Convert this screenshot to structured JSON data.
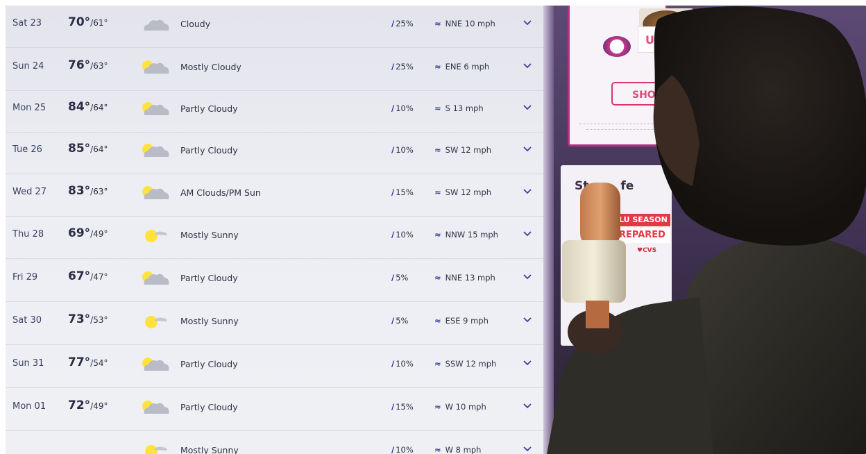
{
  "forecast": {
    "rows": [
      {
        "day": "Sat 23",
        "high": "70°",
        "low": "/61°",
        "condition": "Cloudy",
        "icon": "cloud-icon",
        "precip": "25%",
        "wind": "NNE 10 mph"
      },
      {
        "day": "Sun 24",
        "high": "76°",
        "low": "/63°",
        "condition": "Mostly Cloudy",
        "icon": "sun-cloud-icon",
        "precip": "25%",
        "wind": "ENE 6 mph"
      },
      {
        "day": "Mon 25",
        "high": "84°",
        "low": "/64°",
        "condition": "Partly Cloudy",
        "icon": "sun-cloud-icon",
        "precip": "10%",
        "wind": "S 13 mph"
      },
      {
        "day": "Tue 26",
        "high": "85°",
        "low": "/64°",
        "condition": "Partly Cloudy",
        "icon": "sun-cloud-icon",
        "precip": "10%",
        "wind": "SW 12 mph"
      },
      {
        "day": "Wed 27",
        "high": "83°",
        "low": "/63°",
        "condition": "AM Clouds/PM Sun",
        "icon": "sun-cloud-icon",
        "precip": "15%",
        "wind": "SW 12 mph"
      },
      {
        "day": "Thu 28",
        "high": "69°",
        "low": "/49°",
        "condition": "Mostly Sunny",
        "icon": "sun-icon",
        "precip": "10%",
        "wind": "NNW 15 mph"
      },
      {
        "day": "Fri 29",
        "high": "67°",
        "low": "/47°",
        "condition": "Partly Cloudy",
        "icon": "sun-cloud-icon",
        "precip": "5%",
        "wind": "NNE 13 mph"
      },
      {
        "day": "Sat 30",
        "high": "73°",
        "low": "/53°",
        "condition": "Mostly Sunny",
        "icon": "sun-icon",
        "precip": "5%",
        "wind": "ESE 9 mph"
      },
      {
        "day": "Sun 31",
        "high": "77°",
        "low": "/54°",
        "condition": "Partly Cloudy",
        "icon": "sun-cloud-icon",
        "precip": "10%",
        "wind": "SSW 12 mph"
      },
      {
        "day": "Mon 01",
        "high": "72°",
        "low": "/49°",
        "condition": "Partly Cloudy",
        "icon": "sun-cloud-icon",
        "precip": "15%",
        "wind": "W 10 mph"
      },
      {
        "day": "",
        "high": "",
        "low": "",
        "condition": "Mostly Sunny",
        "icon": "sun-icon",
        "precip": "10%",
        "wind": "W 8 mph"
      }
    ]
  },
  "ads": {
    "brand_partial": "UNKIN",
    "shop_partial": "SHOP",
    "stay_partial": "St",
    "stay_partial_end": "fe",
    "flu_partial": "LU SEASON",
    "prepared_partial": "REPARED",
    "cvs_partial": "♥CVS"
  },
  "colors": {
    "screen_bg": "#eceef3",
    "text": "#2c2f44",
    "accent": "#23279a",
    "ad_border": "#b8307f"
  }
}
